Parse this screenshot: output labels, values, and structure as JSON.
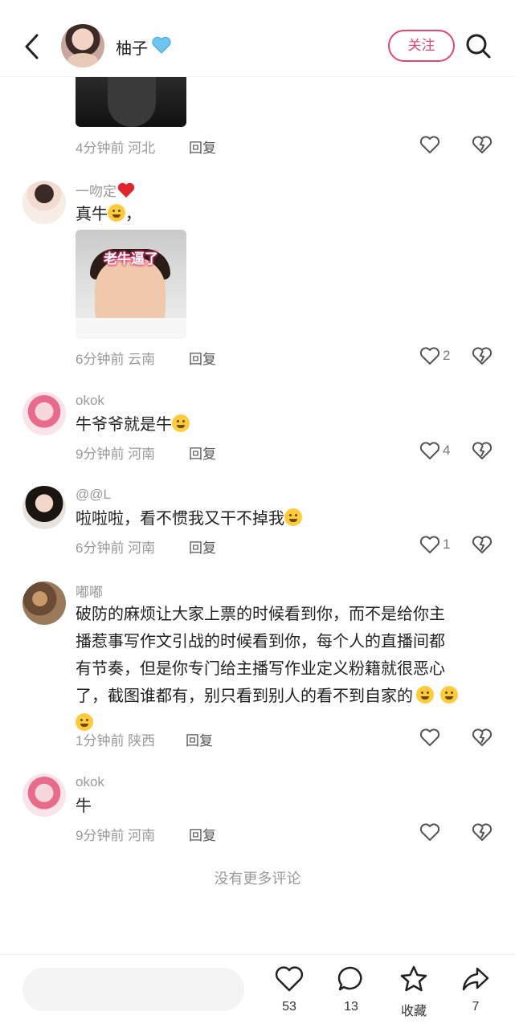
{
  "header": {
    "name": "柚子",
    "follow_label": "关注"
  },
  "comments": [
    {
      "id": "top",
      "time": "4分钟前 河北",
      "reply": "回复"
    },
    {
      "id": "c1",
      "user": "一吻定",
      "text": "真牛",
      "tail": "，",
      "image_caption": "老牛逼了",
      "time": "6分钟前 云南",
      "reply": "回复",
      "likes": "2"
    },
    {
      "id": "c2",
      "user": "okok",
      "text": "牛爷爷就是牛",
      "time": "9分钟前 河南",
      "reply": "回复",
      "likes": "4"
    },
    {
      "id": "c3",
      "user": "@@L",
      "text": "啦啦啦，看不惯我又干不掉我",
      "time": "6分钟前 河南",
      "reply": "回复",
      "likes": "1"
    },
    {
      "id": "c4",
      "user": "嘟嘟",
      "text_lines": [
        "破防的麻烦让大家上票的时候看到你，而不是给你主",
        "播惹事写作文引战的时候看到你，每个人的直播间都",
        "有节奏，但是你专门给主播写作业定义粉籍就很恶心",
        "了，截图谁都有，别只看到别人的看不到自家的"
      ],
      "time": "1分钟前 陕西",
      "reply": "回复"
    },
    {
      "id": "c5",
      "user": "okok",
      "text": "牛",
      "time": "9分钟前 河南",
      "reply": "回复"
    }
  ],
  "no_more": "没有更多评论",
  "bottom": {
    "like_count": "53",
    "comment_count": "13",
    "collect_label": "收藏",
    "share_count": "7"
  },
  "colors": {
    "accent": "#e8456b",
    "muted": "#999999"
  }
}
